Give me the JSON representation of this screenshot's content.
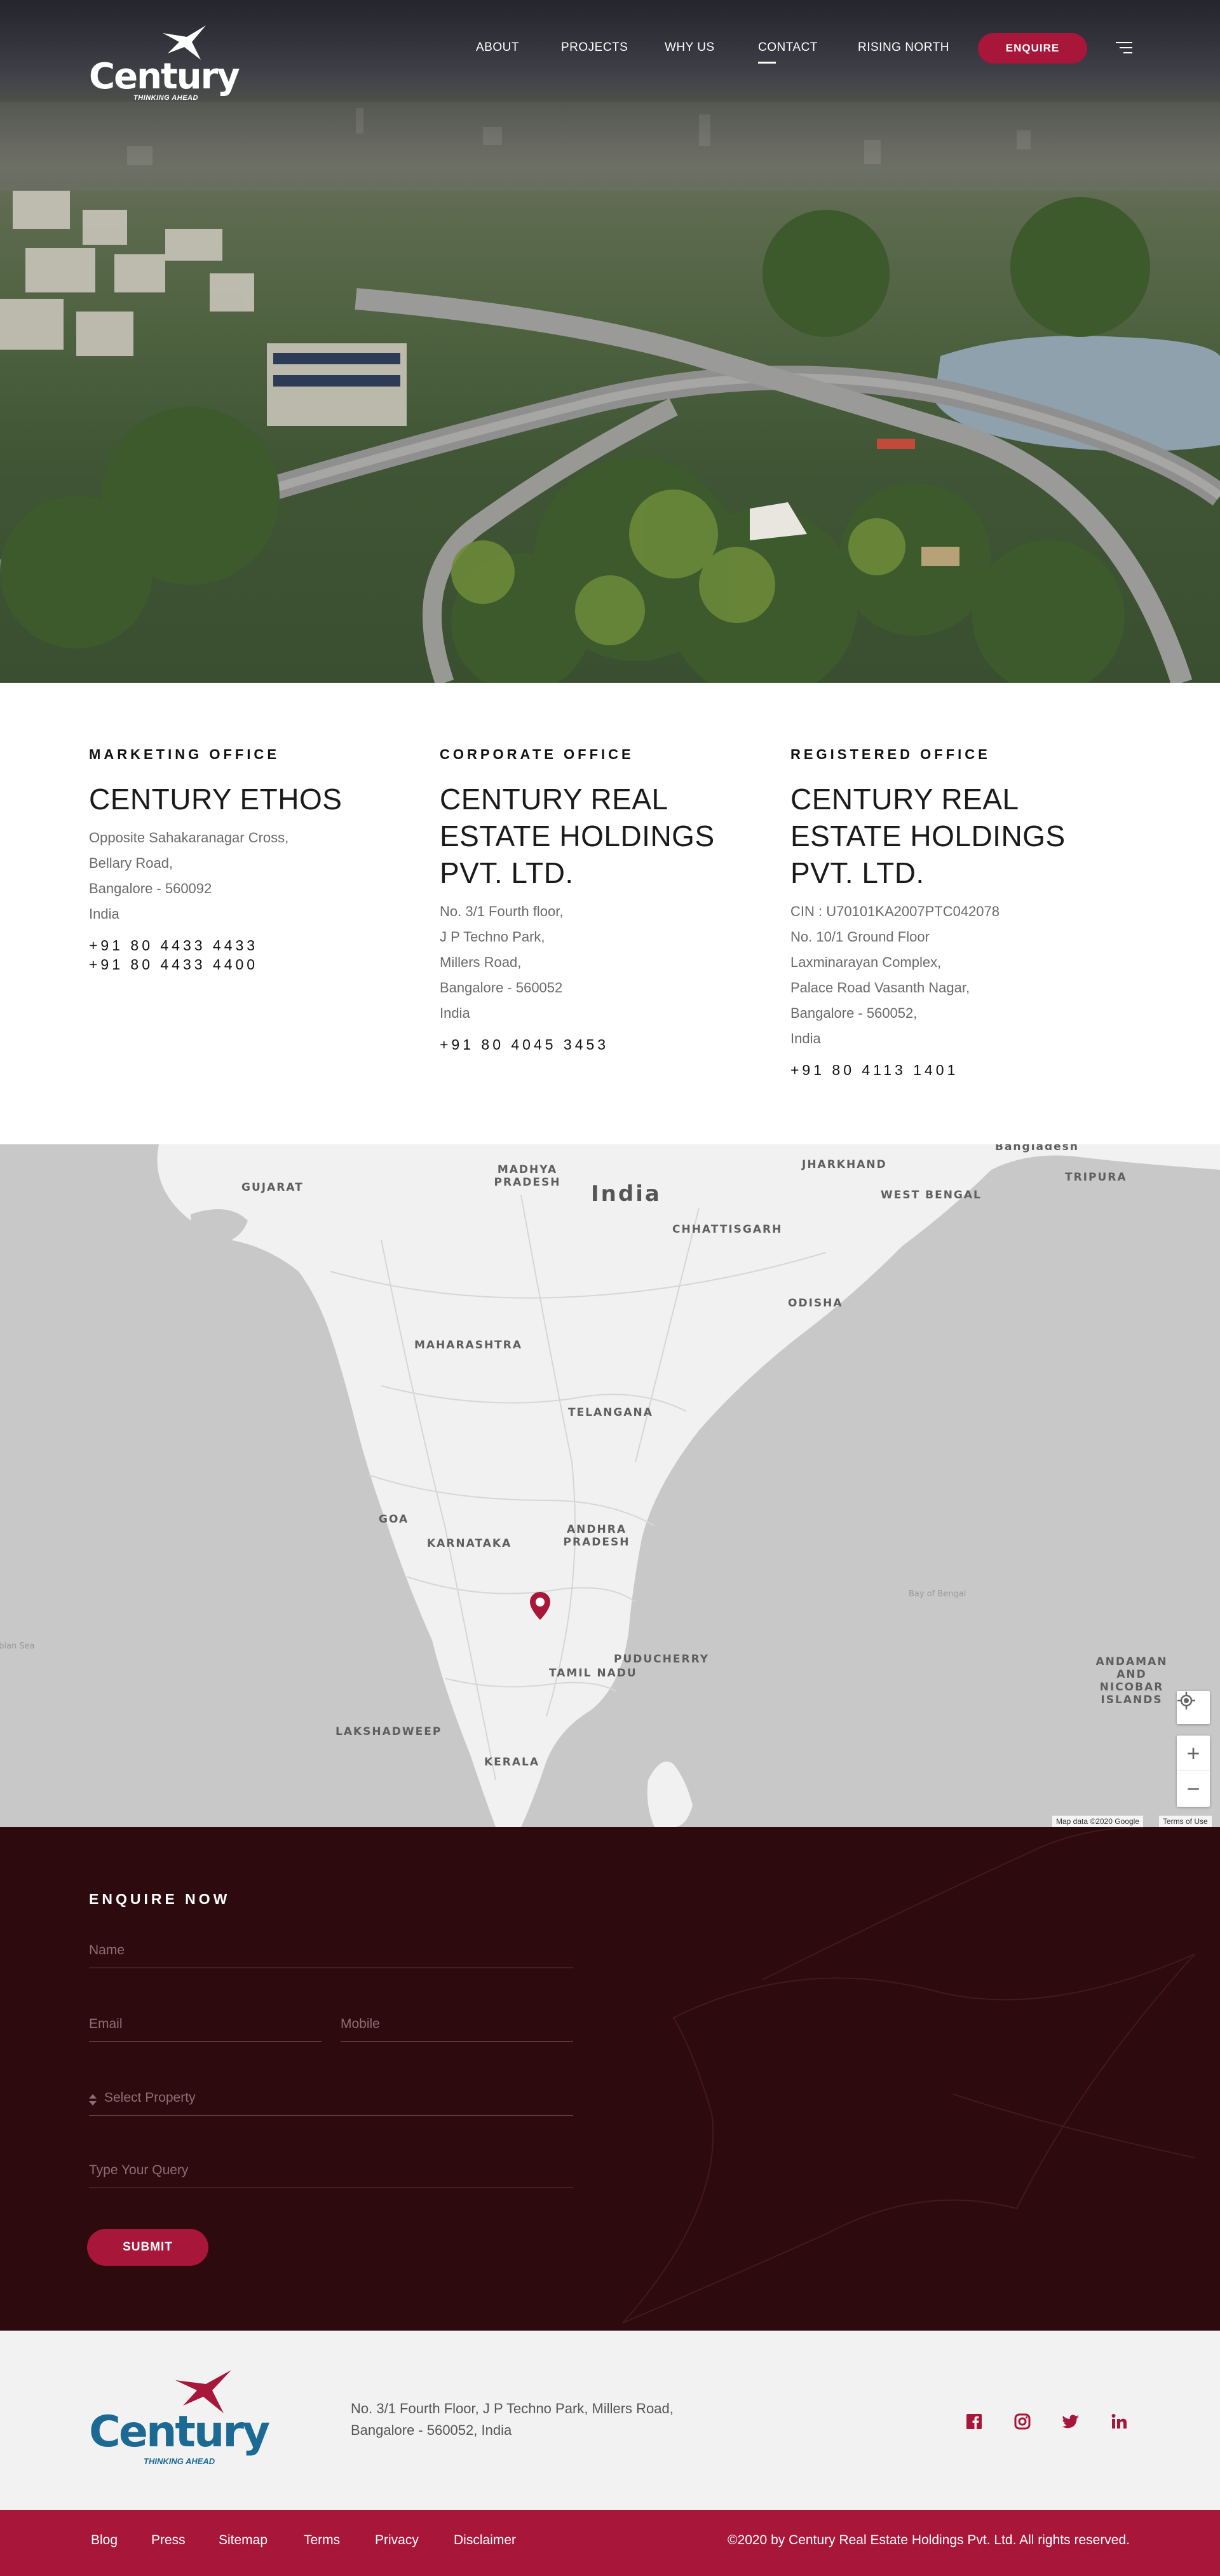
{
  "brand": {
    "name": "Century",
    "tagline": "THINKING AHEAD",
    "accent_color": "#a8163a",
    "footer_logo_color": "#1c6a93"
  },
  "nav": {
    "items": [
      {
        "label": "ABOUT"
      },
      {
        "label": "PROJECTS"
      },
      {
        "label": "WHY US"
      },
      {
        "label": "CONTACT",
        "active": true
      },
      {
        "label": "RISING NORTH"
      }
    ],
    "enquire_label": "ENQUIRE",
    "menu_icon": "hamburger-menu-icon"
  },
  "offices": [
    {
      "heading": "MARKETING OFFICE",
      "name": "CENTURY ETHOS",
      "address_lines": [
        "Opposite Sahakaranagar Cross,",
        "Bellary Road,",
        "Bangalore - 560092",
        "India"
      ],
      "phones": [
        "+91 80 4433 4433",
        "+91 80 4433 4400"
      ]
    },
    {
      "heading": "CORPORATE OFFICE",
      "name": "CENTURY REAL ESTATE HOLDINGS PVT. LTD.",
      "address_lines": [
        "No. 3/1 Fourth floor,",
        "J P Techno Park,",
        "Millers Road,",
        "Bangalore - 560052",
        "India"
      ],
      "phones": [
        "+91 80 4045 3453"
      ]
    },
    {
      "heading": "REGISTERED OFFICE",
      "name": "CENTURY REAL ESTATE HOLDINGS PVT. LTD.",
      "address_lines": [
        "CIN : U70101KA2007PTC042078",
        "No. 10/1 Ground Floor",
        "Laxminarayan Complex,",
        "Palace Road Vasanth Nagar,",
        "Bangalore - 560052,",
        "India"
      ],
      "phones": [
        "+91 80 4113 1401"
      ]
    }
  ],
  "map": {
    "labels": {
      "country": "India",
      "gujarat": "GUJARAT",
      "madhya_pradesh": "MADHYA PRADESH",
      "jharkhand": "JHARKHAND",
      "bangladesh": "Bangladesh",
      "tripura": "TRIPURA",
      "west_bengal": "WEST BENGAL",
      "chhattisgarh": "CHHATTISGARH",
      "odisha": "ODISHA",
      "maharashtra": "MAHARASHTRA",
      "telangana": "TELANGANA",
      "goa": "GOA",
      "karnataka": "KARNATAKA",
      "andhra_pradesh": "ANDHRA PRADESH",
      "bay_of_bengal": "Bay of Bengal",
      "arabian_sea": "Arabian Sea",
      "puducherry": "PUDUCHERRY",
      "tamil_nadu": "TAMIL NADU",
      "andaman": "ANDAMAN AND NICOBAR ISLANDS",
      "lakshadweep": "LAKSHADWEEP",
      "kerala": "KERALA"
    },
    "credit": "Map data ©2020 Google",
    "terms": "Terms of Use",
    "zoom_in": "+",
    "zoom_out": "−"
  },
  "enquire": {
    "title": "ENQUIRE NOW",
    "name_placeholder": "Name",
    "email_placeholder": "Email",
    "mobile_placeholder": "Mobile",
    "property_placeholder": "Select Property",
    "query_placeholder": "Type Your Query",
    "submit_label": "SUBMIT"
  },
  "footer": {
    "address_line1": "No. 3/1 Fourth Floor, J P Techno Park, Millers Road,",
    "address_line2": "Bangalore - 560052, India",
    "social": [
      "facebook-icon",
      "instagram-icon",
      "twitter-icon",
      "linkedin-icon"
    ],
    "links": [
      "Blog",
      "Press",
      "Sitemap",
      "Terms",
      "Privacy",
      "Disclaimer"
    ],
    "copyright": "©2020 by Century Real Estate Holdings Pvt. Ltd. All rights reserved."
  }
}
